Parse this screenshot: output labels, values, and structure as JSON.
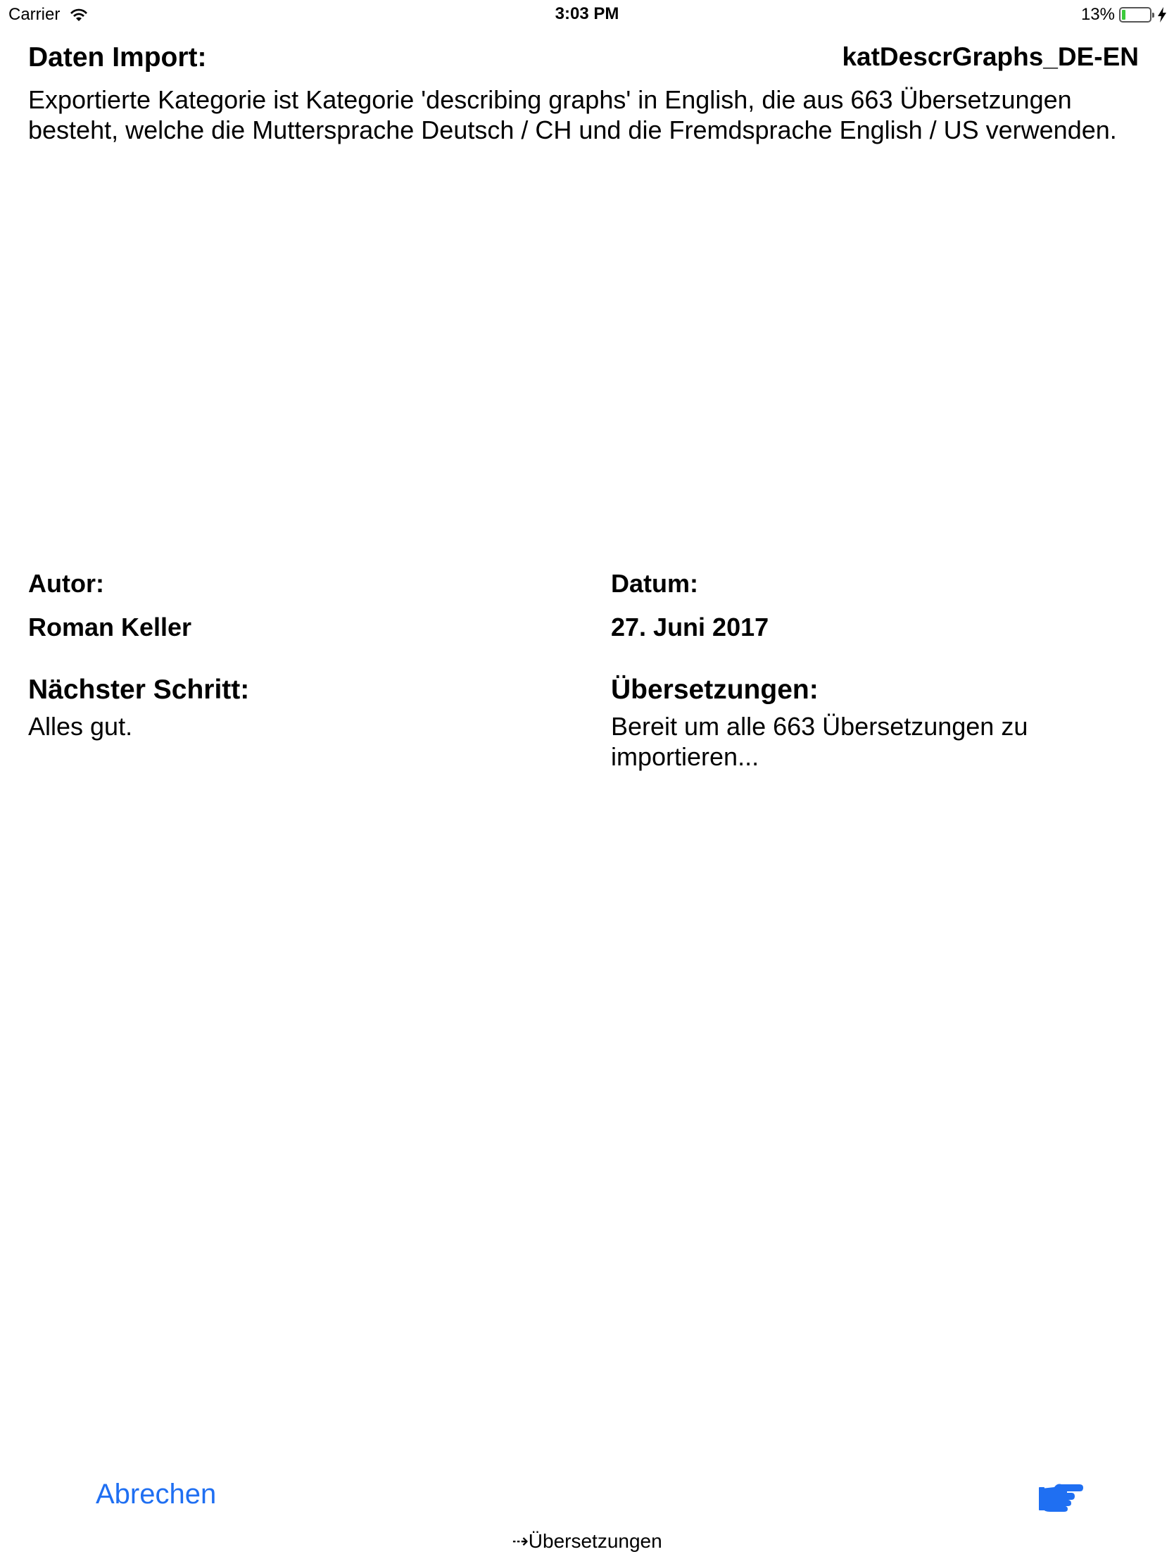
{
  "status_bar": {
    "carrier": "Carrier",
    "time": "3:03 PM",
    "battery_percent": "13%",
    "battery_level": 0.13,
    "icons": [
      "wifi-icon",
      "battery-icon",
      "charging-bolt-icon"
    ]
  },
  "header": {
    "title": "Daten Import:",
    "filename": "katDescrGraphs_DE-EN"
  },
  "description": "Exportierte Kategorie ist Kategorie 'describing graphs' in English, die aus 663 Übersetzungen besteht, welche die Muttersprache Deutsch / CH und die Fremdsprache English / US verwenden.",
  "author": {
    "label": "Autor:",
    "value": "Roman Keller"
  },
  "date": {
    "label": "Datum:",
    "value": "27. Juni 2017"
  },
  "next_step": {
    "label": "Nächster Schritt:",
    "value": "Alles gut."
  },
  "translations": {
    "label": "Übersetzungen:",
    "value": "Bereit um alle 663 Übersetzungen zu importieren..."
  },
  "toolbar": {
    "cancel_label": "Abrechen",
    "next_icon": "pointing-hand-icon"
  },
  "footer": {
    "text": "⇢Übersetzungen"
  },
  "colors": {
    "accent": "#1f6ff2",
    "battery_low": "#3ccb3c"
  }
}
